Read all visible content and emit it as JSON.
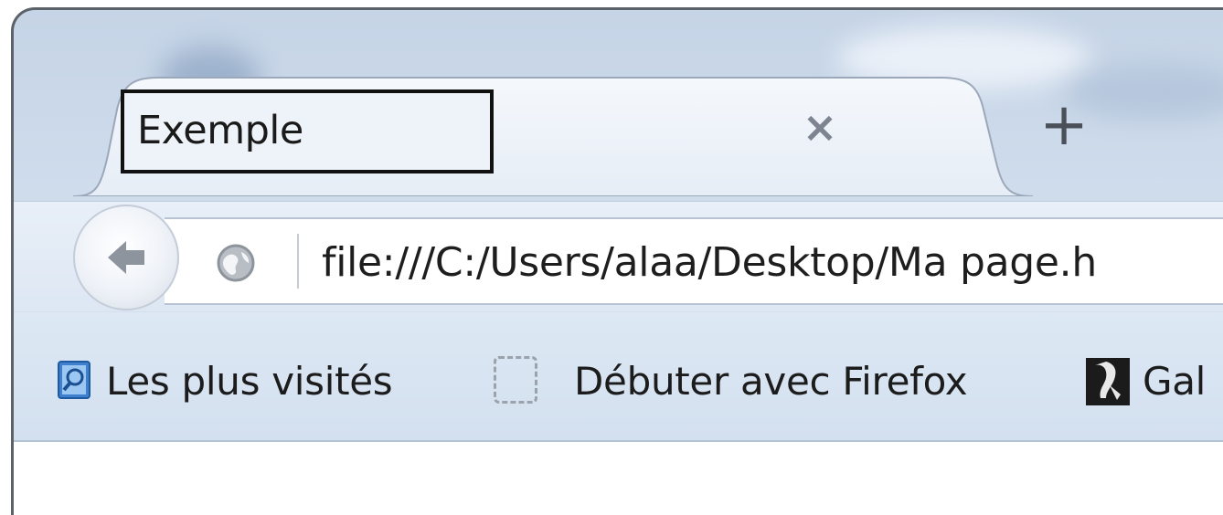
{
  "window": {
    "frame_color": "#5d6168",
    "accent_color": "#c5d4e6"
  },
  "tab": {
    "title": "Exemple",
    "close_glyph": "×",
    "new_tab_glyph": "+",
    "close_icon": "close-icon",
    "new_tab_icon": "plus-icon"
  },
  "navbar": {
    "back_icon": "back-arrow-icon",
    "back_glyph": "🡐",
    "site_icon": "globe-icon",
    "url": "file:///C:/Users/alaa/Desktop/Ma page.h"
  },
  "bookmarks": {
    "items": [
      {
        "label": "Les plus visités",
        "icon": "search-folder-icon"
      },
      {
        "label": "Débuter avec Firefox",
        "icon": "dotted-page-icon"
      },
      {
        "label": "Gal",
        "icon": "gallery-icon"
      }
    ]
  }
}
